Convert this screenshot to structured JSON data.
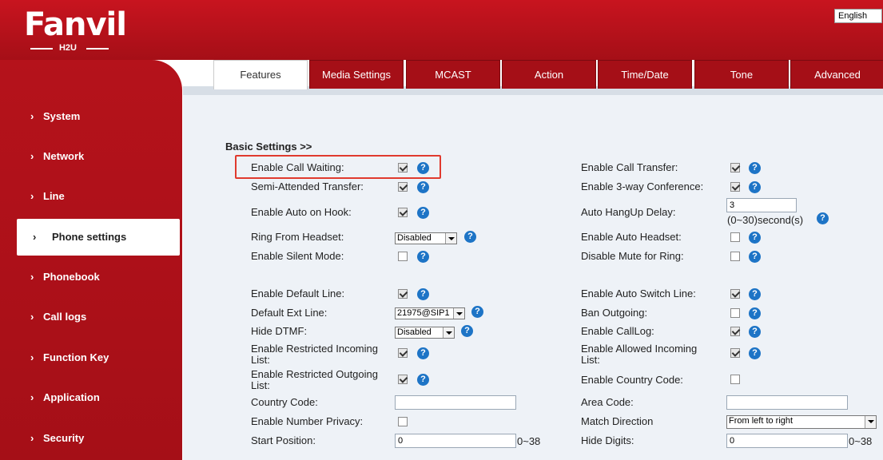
{
  "brand": {
    "logo_text": "Fanvil",
    "logo_sub": "H2U"
  },
  "language": "English",
  "colors": {
    "brand_red": "#b5121b",
    "help_blue": "#1d74c6",
    "highlight": "#e03a2e"
  },
  "sidebar": {
    "items": [
      {
        "label": "System",
        "active": false
      },
      {
        "label": "Network",
        "active": false
      },
      {
        "label": "Line",
        "active": false
      },
      {
        "label": "Phone settings",
        "active": true
      },
      {
        "label": "Phonebook",
        "active": false
      },
      {
        "label": "Call logs",
        "active": false
      },
      {
        "label": "Function Key",
        "active": false
      },
      {
        "label": "Application",
        "active": false
      },
      {
        "label": "Security",
        "active": false
      }
    ],
    "chevron": "›"
  },
  "tabs": [
    {
      "label": "Features",
      "active": true
    },
    {
      "label": "Media Settings",
      "active": false
    },
    {
      "label": "MCAST",
      "active": false
    },
    {
      "label": "Action",
      "active": false
    },
    {
      "label": "Time/Date",
      "active": false
    },
    {
      "label": "Tone",
      "active": false
    },
    {
      "label": "Advanced",
      "active": false
    }
  ],
  "form": {
    "section_title": "Basic Settings >>",
    "help_glyph": "?",
    "left": {
      "enable_call_waiting": {
        "label": "Enable Call Waiting:",
        "checked": true
      },
      "semi_attended_transfer": {
        "label": "Semi-Attended Transfer:",
        "checked": true
      },
      "enable_auto_on_hook": {
        "label": "Enable Auto on Hook:",
        "checked": true
      },
      "ring_from_headset": {
        "label": "Ring From Headset:",
        "value": "Disabled"
      },
      "enable_silent_mode": {
        "label": "Enable Silent Mode:",
        "checked": false
      },
      "enable_default_line": {
        "label": "Enable Default Line:",
        "checked": true
      },
      "default_ext_line": {
        "label": "Default Ext Line:",
        "value": "21975@SIP1"
      },
      "hide_dtmf": {
        "label": "Hide DTMF:",
        "value": "Disabled"
      },
      "enable_restricted_incoming": {
        "label_line1": "Enable Restricted Incoming",
        "label_line2": "List:",
        "checked": true
      },
      "enable_restricted_outgoing": {
        "label_line1": "Enable Restricted Outgoing",
        "label_line2": "List:",
        "checked": true
      },
      "country_code": {
        "label": "Country Code:",
        "value": ""
      },
      "enable_number_privacy": {
        "label": "Enable Number Privacy:",
        "checked": false
      },
      "start_position": {
        "label": "Start Position:",
        "value": "0",
        "hint": "0~38"
      }
    },
    "right": {
      "enable_call_transfer": {
        "label": "Enable Call Transfer:",
        "checked": true
      },
      "enable_3way_conference": {
        "label": "Enable 3-way Conference:",
        "checked": true
      },
      "auto_hangup_delay": {
        "label": "Auto HangUp Delay:",
        "value": "3",
        "hint": "(0~30)second(s)"
      },
      "enable_auto_headset": {
        "label": "Enable Auto Headset:",
        "checked": false
      },
      "disable_mute_for_ring": {
        "label": "Disable Mute for Ring:",
        "checked": false
      },
      "enable_auto_switch_line": {
        "label": "Enable Auto Switch Line:",
        "checked": true
      },
      "ban_outgoing": {
        "label": "Ban Outgoing:",
        "checked": false
      },
      "enable_calllog": {
        "label": "Enable CallLog:",
        "checked": true
      },
      "enable_allowed_incoming": {
        "label_line1": "Enable Allowed Incoming",
        "label_line2": "List:",
        "checked": true
      },
      "enable_country_code": {
        "label": "Enable Country Code:",
        "checked": false
      },
      "area_code": {
        "label": "Area Code:",
        "value": ""
      },
      "match_direction": {
        "label": "Match Direction",
        "value": "From left to right"
      },
      "hide_digits": {
        "label": "Hide Digits:",
        "value": "0",
        "hint": "0~38"
      }
    }
  }
}
